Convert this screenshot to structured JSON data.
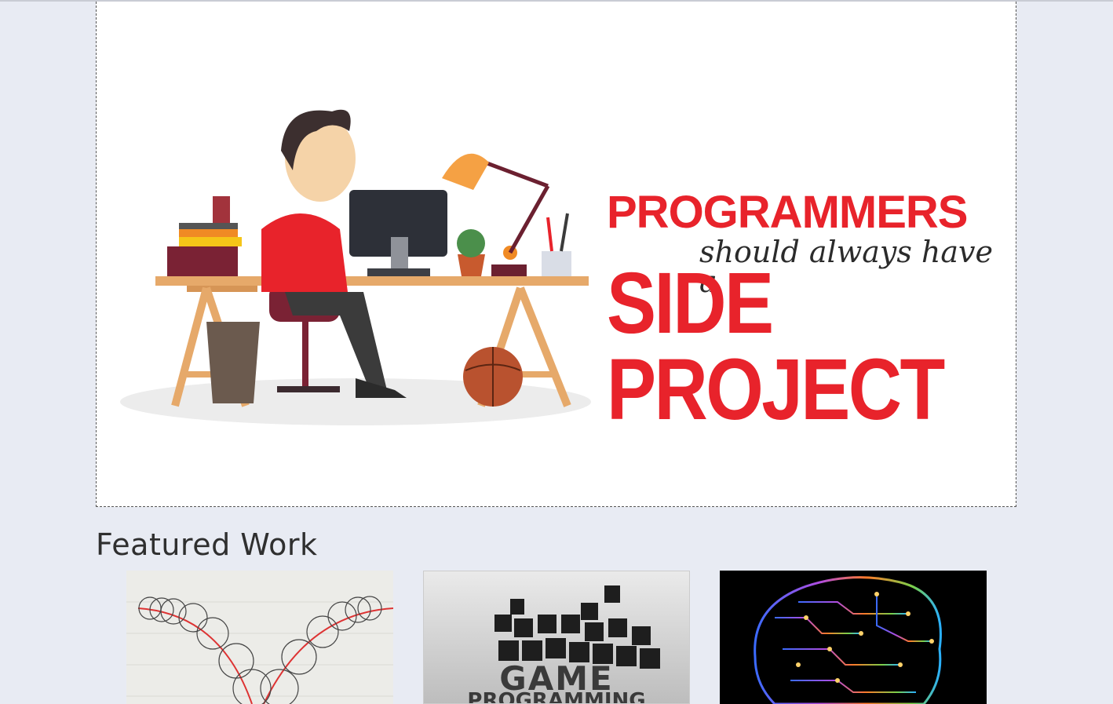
{
  "hero": {
    "line1": "PROGRAMMERS",
    "line2": "should always have a",
    "line3": "SIDE PROJECT"
  },
  "featured": {
    "title": "Featured Work"
  },
  "cards": [
    {
      "label": ""
    },
    {
      "label": "GAME",
      "label2": "PROGRAMMING"
    },
    {
      "label": ""
    }
  ],
  "colors": {
    "background": "#e8ebf3",
    "accent_red": "#e8232b"
  }
}
